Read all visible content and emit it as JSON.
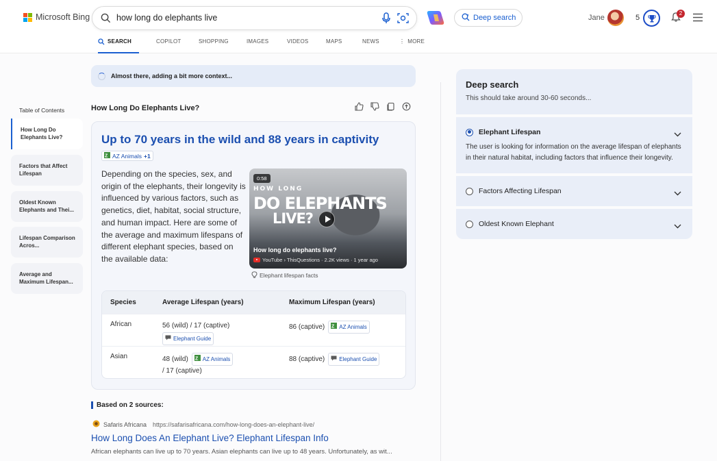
{
  "header": {
    "logo_text": "Microsoft Bing",
    "search_query": "how long do elephants live",
    "deep_search_label": "Deep search",
    "user_name": "Jane",
    "points": "5",
    "notification_count": "2"
  },
  "tabs": [
    {
      "label": "SEARCH",
      "active": true
    },
    {
      "label": "COPILOT"
    },
    {
      "label": "SHOPPING"
    },
    {
      "label": "IMAGES"
    },
    {
      "label": "VIDEOS"
    },
    {
      "label": "MAPS"
    },
    {
      "label": "NEWS"
    },
    {
      "label": "MORE"
    }
  ],
  "status_text": "Almost there, adding a bit more context...",
  "toc": {
    "title": "Table of Contents",
    "items": [
      {
        "label": "How Long Do Elephants Live?",
        "active": true
      },
      {
        "label": "Factors that Affect Lifespan"
      },
      {
        "label": "Oldest Known Elephants and Thei..."
      },
      {
        "label": "Lifespan Comparison Acros..."
      },
      {
        "label": "Average and Maximum Lifespan..."
      }
    ]
  },
  "main": {
    "heading": "How Long Do Elephants Live?",
    "answer_title": "Up to 70 years in the wild and 88 years in captivity",
    "answer_source": "AZ Animals",
    "answer_source_more": "+1",
    "answer_text": "Depending on the species, sex, and origin of the elephants, their longevity is influenced by various factors, such as genetics, diet, habitat, social structure, and human impact. Here are some of the average and maximum lifespans of different elephant species, based on the available data:",
    "video": {
      "duration": "0:58",
      "overlay_line1": "HOW LONG",
      "overlay_line2": "DO ELEPHANTS",
      "overlay_line3": "LIVE?",
      "title": "How long do elephants live?",
      "meta": "YouTube › ThisQuestions · 2.2K views · 1 year ago",
      "caption": "Elephant lifespan facts"
    },
    "table": {
      "headers": [
        "Species",
        "Average Lifespan (years)",
        "Maximum Lifespan (years)"
      ],
      "rows": [
        {
          "species": "African",
          "avg_text": "56 (wild) / 17 (captive)",
          "avg_source": "Elephant Guide",
          "max_text": "86 (captive)",
          "max_source": "AZ Animals"
        },
        {
          "species": "Asian",
          "avg_text": "48 (wild)",
          "avg_source": "AZ Animals",
          "avg_text2": "/ 17 (captive)",
          "max_text": "88 (captive)",
          "max_source": "Elephant Guide"
        }
      ]
    }
  },
  "sources": {
    "heading": "Based on 2 sources:",
    "site_name": "Safaris Africana",
    "url": "https://safarisafricana.com/how-long-does-an-elephant-live/",
    "title": "How Long Does An Elephant Live? Elephant Lifespan Info",
    "snippet": "African elephants can live up to 70 years. Asian elephants can live up to 48 years. Unfortunately, as wit..."
  },
  "deep_search": {
    "title": "Deep search",
    "subtitle": "This should take around 30-60 seconds...",
    "items": [
      {
        "label": "Elephant Lifespan",
        "expanded": true,
        "description": "The user is looking for information on the average lifespan of elephants in their natural habitat, including factors that influence their longevity."
      },
      {
        "label": "Factors Affecting Lifespan"
      },
      {
        "label": "Oldest Known Elephant"
      }
    ]
  },
  "colors": {
    "accent": "#1b4fb0",
    "link": "#1a5fd0",
    "panel_bg": "#e9eef8"
  }
}
